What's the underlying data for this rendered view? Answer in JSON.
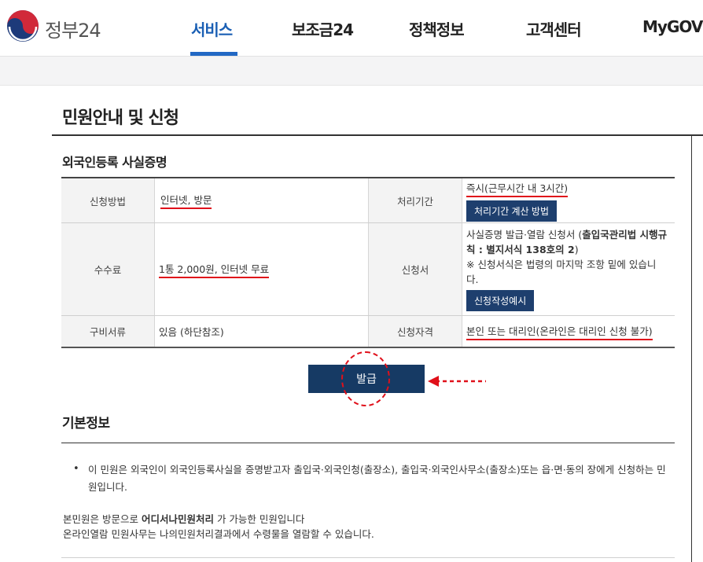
{
  "header": {
    "logo_text": "정부24",
    "nav": [
      {
        "label": "서비스",
        "active": true
      },
      {
        "label": "보조금24",
        "active": false
      },
      {
        "label": "정책정보",
        "active": false
      },
      {
        "label": "고객센터",
        "active": false
      },
      {
        "label": "MyGOV",
        "active": false
      }
    ]
  },
  "page": {
    "title": "민원안내 및 신청",
    "section_title": "외국인등록 사실증명"
  },
  "table": {
    "method_label": "신청방법",
    "method_value": "인터넷, 방문",
    "period_label": "처리기간",
    "period_value": "즉시(근무시간 내 3시간)",
    "period_button": "처리기간 계산 방법",
    "fee_label": "수수료",
    "fee_value": "1통 2,000원, 인터넷 무료",
    "form_label": "신청서",
    "form_text_1": "사실증명 발급·열람 신청서 (",
    "form_text_bold": "출입국관리법 시행규칙 : 별지서식 138호의 2",
    "form_text_2": ")",
    "form_note": "※ 신청서식은 법령의 마지막 조항 밑에 있습니다.",
    "form_button": "신청작성예시",
    "docs_label": "구비서류",
    "docs_value": "있음 (하단참조)",
    "qual_label": "신청자격",
    "qual_value": "본인 또는 대리인(온라인은 대리인 신청 불가)"
  },
  "issue_button": "발급",
  "info": {
    "title": "기본정보",
    "bullet_text": "이 민원은 외국인이 외국인등록사실을 증명받고자 출입국·외국인청(출장소), 출입국·외국인사무소(출장소)또는 읍·면·동의 장에게 신청하는 민원입니다.",
    "line2_a": "본민원은 방문으로 ",
    "line2_bold": "어디서나민원처리",
    "line2_b": " 가 가능한 민원입니다",
    "line3": "온라인열람 민원사무는 나의민원처리결과에서 수령물을 열람할 수 있습니다."
  },
  "colors": {
    "accent": "#1a5fb4",
    "button": "#1e3f6e",
    "highlight": "#e0101a"
  }
}
